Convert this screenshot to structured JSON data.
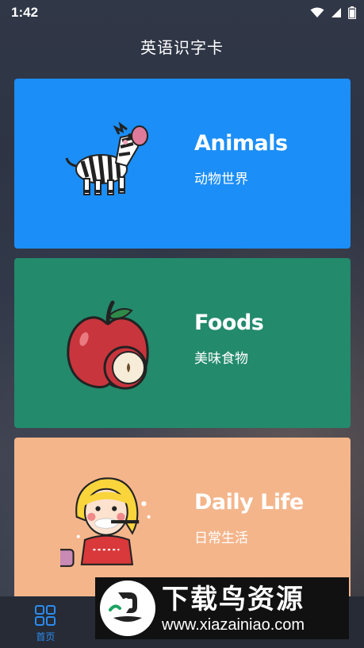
{
  "status_bar": {
    "time": "1:42",
    "icons": [
      "wifi-icon",
      "signal-icon",
      "battery-icon"
    ]
  },
  "header": {
    "title": "英语识字卡"
  },
  "cards": [
    {
      "title": "Animals",
      "subtitle": "动物世界",
      "color": "#1b8ef7",
      "icon": "zebra-icon"
    },
    {
      "title": "Foods",
      "subtitle": "美味食物",
      "color": "#238a6c",
      "icon": "apple-icon"
    },
    {
      "title": "Daily Life",
      "subtitle": "日常生活",
      "color": "#f4b58b",
      "icon": "girl-brushing-teeth-icon"
    }
  ],
  "bottom_nav": {
    "items": [
      {
        "label": "首页",
        "icon": "grid-icon",
        "active": true
      },
      {
        "label": "",
        "icon": "tab-2-icon",
        "active": false
      },
      {
        "label": "",
        "icon": "tab-3-icon",
        "active": false
      },
      {
        "label": "",
        "icon": "tab-4-icon",
        "active": false
      }
    ],
    "active_color": "#2b8cf0"
  },
  "watermark": {
    "main": "下载鸟资源",
    "url": "www.xiazainiao.com"
  }
}
